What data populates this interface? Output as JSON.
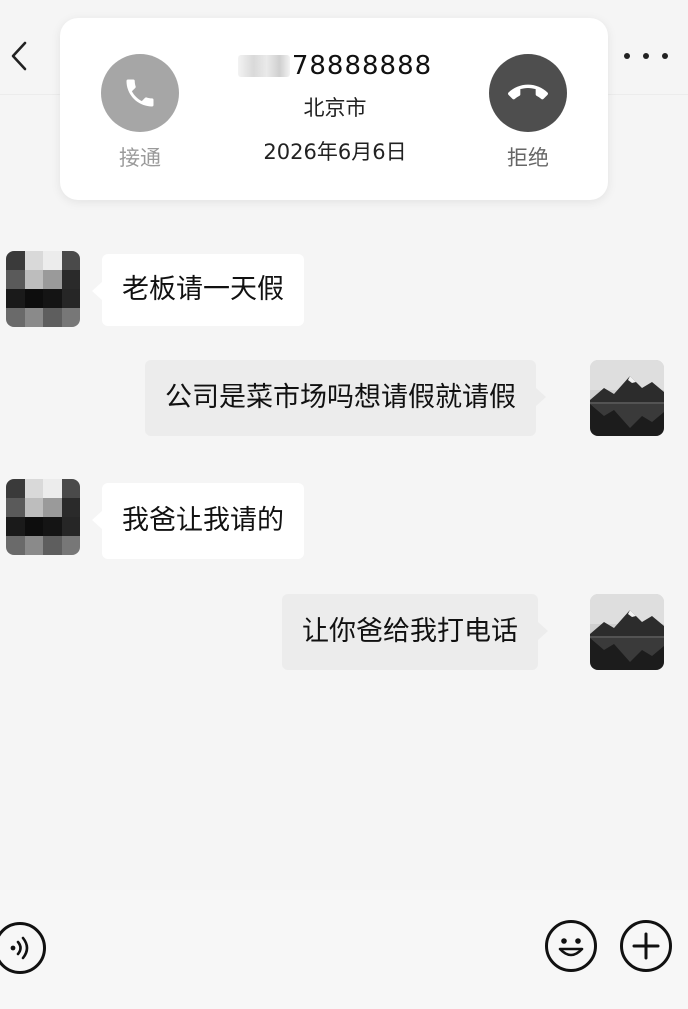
{
  "call_card": {
    "number": "78888888",
    "city": "北京市",
    "date": "2026年6月6日",
    "accept_label": "接通",
    "reject_label": "拒绝"
  },
  "messages": [
    {
      "side": "left",
      "text": "老板请一天假"
    },
    {
      "side": "right",
      "text": "公司是菜市场吗想请假就请假"
    },
    {
      "side": "left",
      "text": "我爸让我请的"
    },
    {
      "side": "right",
      "text": "让你爸给我打电话"
    }
  ],
  "icons": {
    "back": "chevron-left-icon",
    "more": "more-dots-icon",
    "accept": "phone-icon",
    "reject": "phone-hangup-icon",
    "voice": "voice-icon",
    "emoji": "emoji-icon",
    "plus": "plus-icon"
  },
  "colors": {
    "background": "#f5f5f5",
    "accept_button": "#a6a6a6",
    "reject_button": "#4e4e4e",
    "left_bubble": "#ffffff",
    "right_bubble": "#ececec"
  }
}
